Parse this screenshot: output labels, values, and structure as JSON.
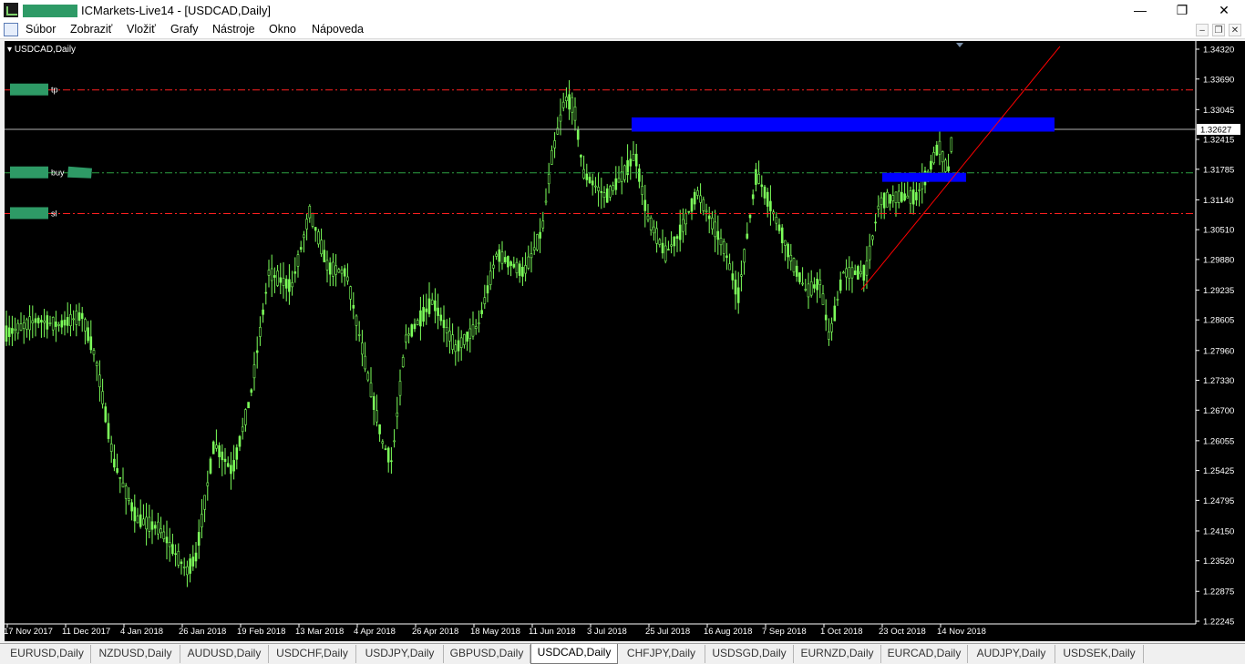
{
  "window": {
    "title": "ICMarkets-Live14 - [USDCAD,Daily]",
    "minimize_glyph": "—",
    "maximize_glyph": "❐",
    "close_glyph": "✕"
  },
  "menu": {
    "items": [
      "Súbor",
      "Zobraziť",
      "Vložiť",
      "Grafy",
      "Nástroje",
      "Okno",
      "Nápoveda"
    ],
    "mdi_minimize": "–",
    "mdi_restore": "❐",
    "mdi_close": "✕"
  },
  "chart": {
    "symbol_label": "USDCAD,Daily",
    "price_axis_labels": [
      "1.34320",
      "1.33690",
      "1.33045",
      "1.32415",
      "1.31785",
      "1.31140",
      "1.30510",
      "1.29880",
      "1.29235",
      "1.28605",
      "1.27960",
      "1.27330",
      "1.26700",
      "1.26055",
      "1.25425",
      "1.24795",
      "1.24150",
      "1.23520",
      "1.22875",
      "1.22245"
    ],
    "current_price": "1.32627",
    "date_axis_labels": [
      "17 Nov 2017",
      "11 Dec 2017",
      "4 Jan 2018",
      "26 Jan 2018",
      "19 Feb 2018",
      "13 Mar 2018",
      "4 Apr 2018",
      "26 Apr 2018",
      "18 May 2018",
      "11 Jun 2018",
      "3 Jul 2018",
      "25 Jul 2018",
      "16 Aug 2018",
      "7 Sep 2018",
      "1 Oct 2018",
      "23 Oct 2018",
      "14 Nov 2018"
    ],
    "levels": [
      {
        "label": "tp",
        "price": 1.3346,
        "color": "#ff2020",
        "style": "dash-dot"
      },
      {
        "label": "buy",
        "price": 1.3171,
        "color": "#2ea043",
        "style": "dash-dot"
      },
      {
        "label": "sl",
        "price": 1.3085,
        "color": "#ff2020",
        "style": "dash-dot"
      },
      {
        "label": "",
        "price": 1.32627,
        "color": "#b0b0b0",
        "style": "solid"
      }
    ],
    "zones": [
      {
        "price_top": 1.3288,
        "price_bottom": 1.3258,
        "color": "#0000ff"
      },
      {
        "price_top": 1.3171,
        "price_bottom": 1.3152,
        "color": "#0000ff"
      }
    ],
    "trendline_color": "#ff0000",
    "candle_color": "#7cff5a",
    "mask_color": "#2e9a66"
  },
  "tabs": {
    "items": [
      "EURUSD,Daily",
      "NZDUSD,Daily",
      "AUDUSD,Daily",
      "USDCHF,Daily",
      "USDJPY,Daily",
      "GBPUSD,Daily",
      "USDCAD,Daily",
      "CHFJPY,Daily",
      "USDSGD,Daily",
      "EURNZD,Daily",
      "EURCAD,Daily",
      "AUDJPY,Daily",
      "USDSEK,Daily"
    ],
    "active": "USDCAD,Daily"
  }
}
